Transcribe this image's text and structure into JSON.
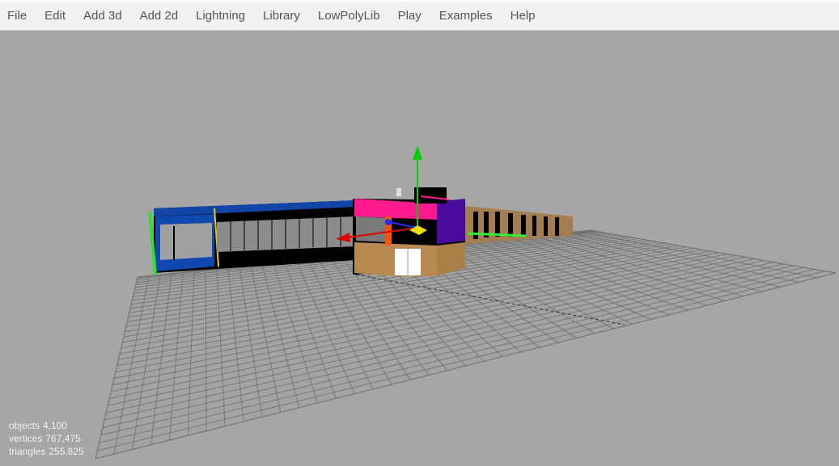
{
  "menu": {
    "items": [
      {
        "label": "File"
      },
      {
        "label": "Edit"
      },
      {
        "label": "Add 3d"
      },
      {
        "label": "Add 2d"
      },
      {
        "label": "Lightning"
      },
      {
        "label": "Library"
      },
      {
        "label": "LowPolyLib"
      },
      {
        "label": "Play"
      },
      {
        "label": "Examples"
      },
      {
        "label": "Help"
      }
    ]
  },
  "viewport": {
    "background_color": "#a6a6a6",
    "grid_color": "#6e6e6e",
    "gizmo": {
      "y_axis_color": "#00cc00",
      "x_axis_color": "#e00000",
      "z_axis_color": "#2a2aff"
    }
  },
  "stats": {
    "objects_label": "objects",
    "objects_value": "4,100",
    "vertices_label": "vertices",
    "vertices_value": "767,475",
    "triangles_label": "triangles",
    "triangles_value": "255,825"
  }
}
